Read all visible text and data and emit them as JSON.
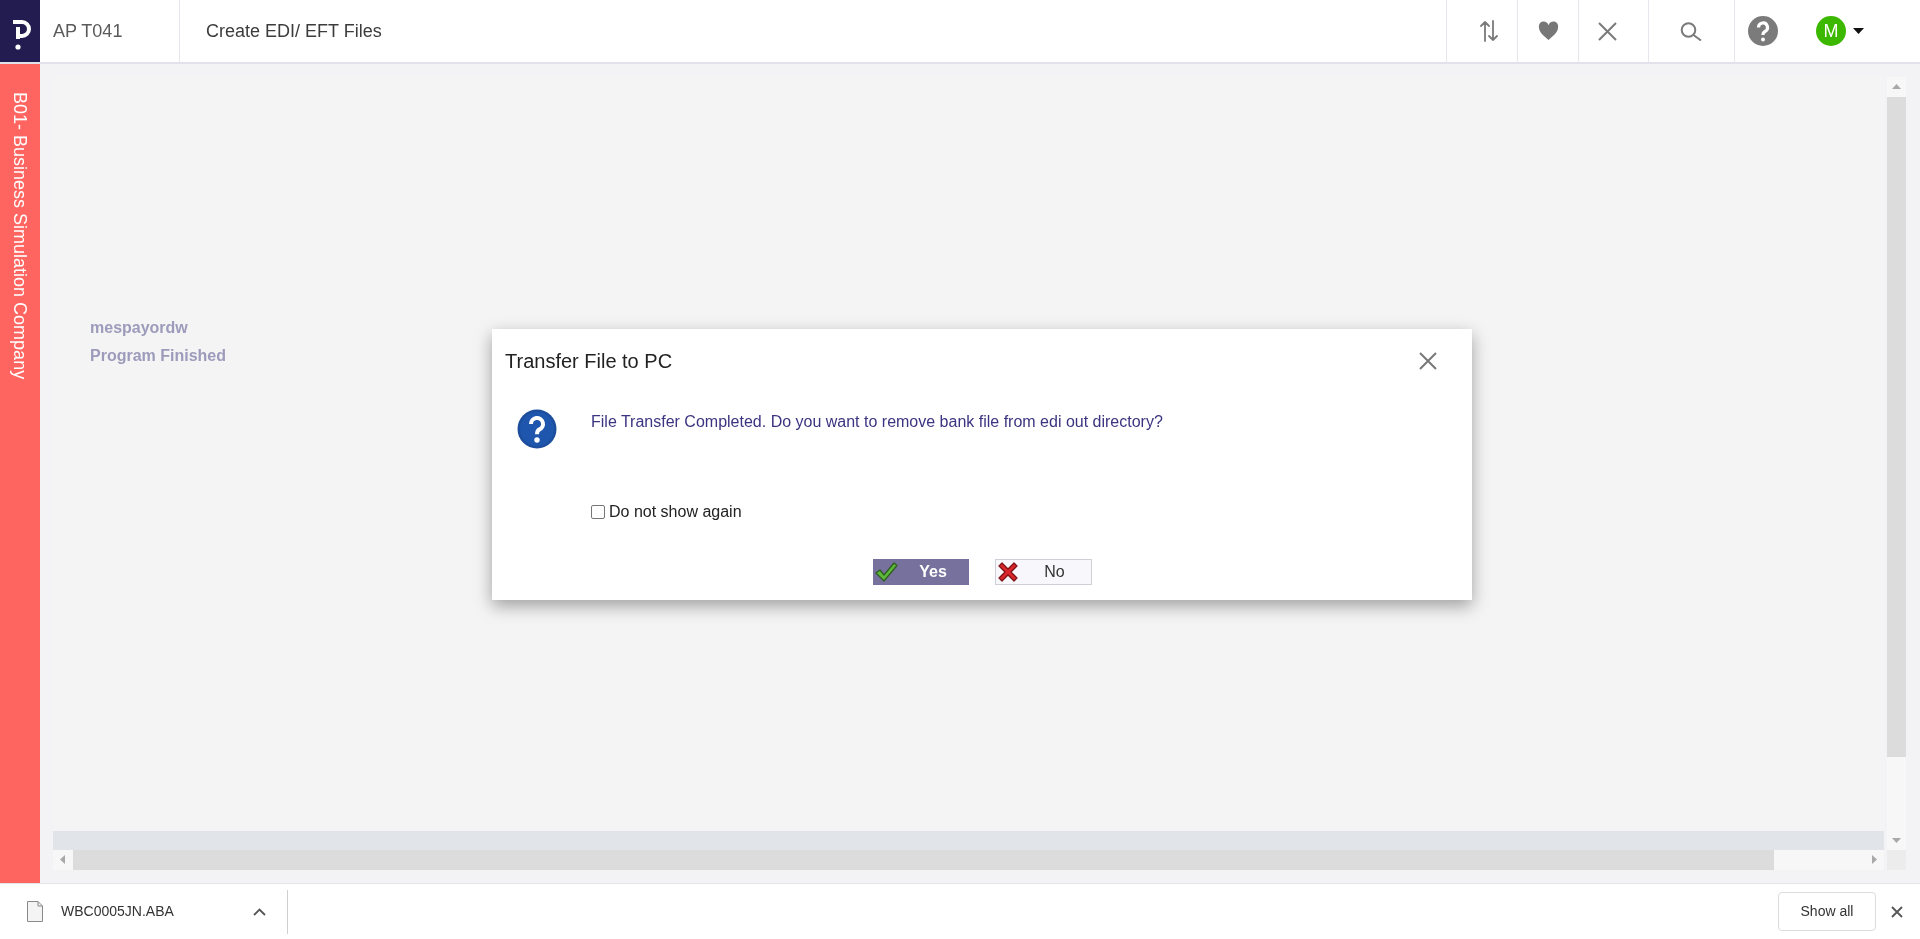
{
  "header": {
    "app_code": "AP T041",
    "title": "Create EDI/ EFT Files",
    "avatar_initial": "M"
  },
  "sidebar": {
    "company": "B01- Business Simulation Company"
  },
  "content": {
    "lines": [
      "mespayordw",
      "Program Finished"
    ]
  },
  "dialog": {
    "title": "Transfer File to PC",
    "message": "File Transfer Completed. Do you want to remove bank file from edi out directory?",
    "checkbox": {
      "label": "Do not show again",
      "checked": false
    },
    "buttons": [
      {
        "label": "Yes",
        "kind": "confirm"
      },
      {
        "label": "No",
        "kind": "cancel"
      }
    ]
  },
  "download_bar": {
    "file_name": "WBC0005JN.ABA",
    "show_all": "Show all"
  }
}
